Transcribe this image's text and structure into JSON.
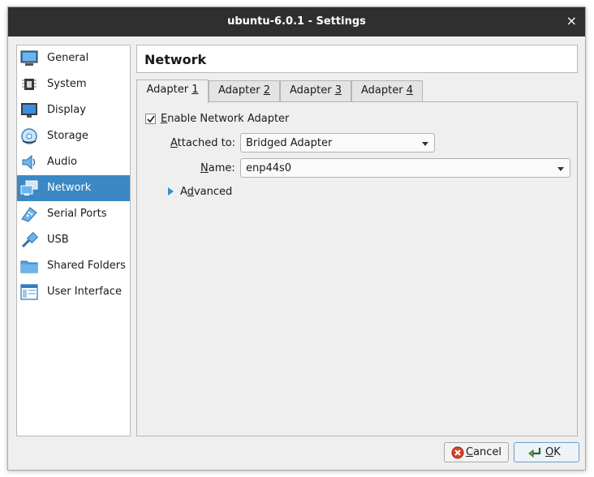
{
  "window": {
    "title": "ubuntu-6.0.1 - Settings",
    "close_glyph": "×"
  },
  "sidebar": {
    "selected": "Network",
    "items": [
      {
        "label": "General",
        "icon": "general-icon"
      },
      {
        "label": "System",
        "icon": "system-icon"
      },
      {
        "label": "Display",
        "icon": "display-icon"
      },
      {
        "label": "Storage",
        "icon": "storage-icon"
      },
      {
        "label": "Audio",
        "icon": "audio-icon"
      },
      {
        "label": "Network",
        "icon": "network-icon"
      },
      {
        "label": "Serial Ports",
        "icon": "serial-ports-icon"
      },
      {
        "label": "USB",
        "icon": "usb-icon"
      },
      {
        "label": "Shared Folders",
        "icon": "shared-folders-icon"
      },
      {
        "label": "User Interface",
        "icon": "user-interface-icon"
      }
    ]
  },
  "page": {
    "title": "Network"
  },
  "tabs": [
    {
      "prefix": "Adapter ",
      "mnemonic": "1",
      "active": true
    },
    {
      "prefix": "Adapter ",
      "mnemonic": "2",
      "active": false
    },
    {
      "prefix": "Adapter ",
      "mnemonic": "3",
      "active": false
    },
    {
      "prefix": "Adapter ",
      "mnemonic": "4",
      "active": false
    }
  ],
  "adapter": {
    "enable": {
      "mnemonic": "E",
      "rest": "nable Network Adapter",
      "checked": true
    },
    "attached_to": {
      "mnemonic": "A",
      "rest": "ttached to:",
      "value": "Bridged Adapter"
    },
    "name": {
      "mnemonic": "N",
      "rest": "ame:",
      "value": "enp44s0"
    },
    "advanced": {
      "pre": "A",
      "mnemonic": "d",
      "rest": "vanced",
      "expanded": false
    }
  },
  "buttons": {
    "cancel": {
      "mnemonic": "C",
      "rest": "ancel",
      "icon": "cancel-icon"
    },
    "ok": {
      "mnemonic": "O",
      "rest": "K",
      "icon": "ok-icon"
    }
  },
  "colors": {
    "selection": "#3b88c4",
    "titlebar": "#2f2f2f",
    "accent": "#2d8fd5"
  }
}
